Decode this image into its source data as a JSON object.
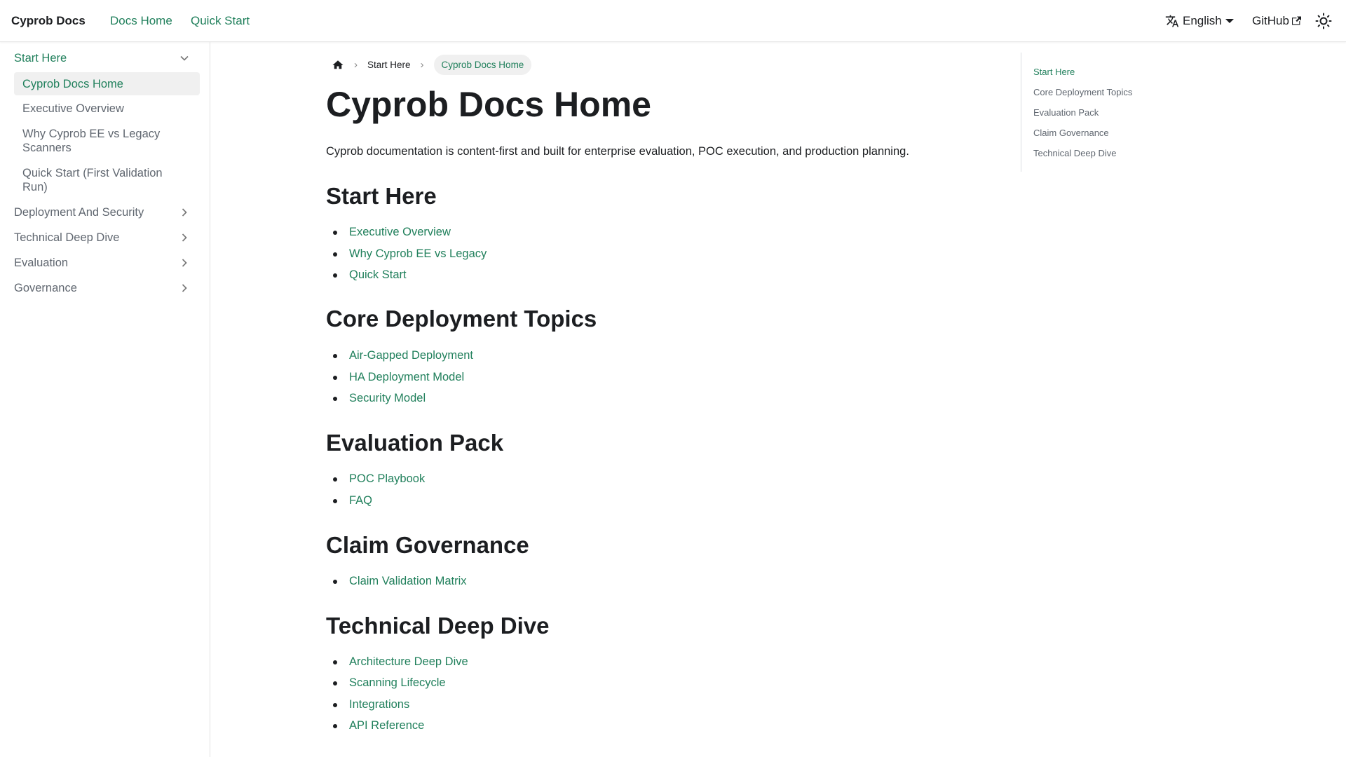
{
  "header": {
    "brand": "Cyprob Docs",
    "nav": [
      "Docs Home",
      "Quick Start"
    ],
    "language": "English",
    "github": "GitHub"
  },
  "sidebar": {
    "start_here": "Start Here",
    "sub_items": [
      "Cyprob Docs Home",
      "Executive Overview",
      "Why Cyprob EE vs Legacy Scanners",
      "Quick Start (First Validation Run)"
    ],
    "categories": [
      "Deployment And Security",
      "Technical Deep Dive",
      "Evaluation",
      "Governance"
    ]
  },
  "breadcrumb": {
    "parent": "Start Here",
    "current": "Cyprob Docs Home"
  },
  "page": {
    "title": "Cyprob Docs Home",
    "lead": "Cyprob documentation is content-first and built for enterprise evaluation, POC execution, and production planning.",
    "sections": [
      {
        "heading": "Start Here",
        "links": [
          "Executive Overview",
          "Why Cyprob EE vs Legacy",
          "Quick Start"
        ]
      },
      {
        "heading": "Core Deployment Topics",
        "links": [
          "Air-Gapped Deployment",
          "HA Deployment Model",
          "Security Model"
        ]
      },
      {
        "heading": "Evaluation Pack",
        "links": [
          "POC Playbook",
          "FAQ"
        ]
      },
      {
        "heading": "Claim Governance",
        "links": [
          "Claim Validation Matrix"
        ]
      },
      {
        "heading": "Technical Deep Dive",
        "links": [
          "Architecture Deep Dive",
          "Scanning Lifecycle",
          "Integrations",
          "API Reference"
        ]
      }
    ]
  },
  "toc": [
    "Start Here",
    "Core Deployment Topics",
    "Evaluation Pack",
    "Claim Governance",
    "Technical Deep Dive"
  ],
  "colors": {
    "accent": "#21805c"
  }
}
